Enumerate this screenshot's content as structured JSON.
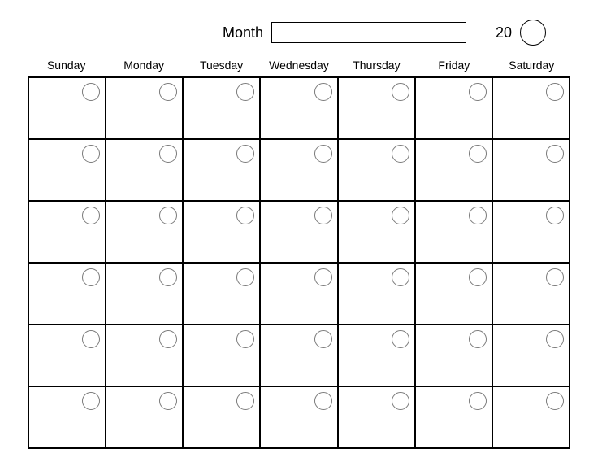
{
  "header": {
    "month_label": "Month",
    "month_value": "",
    "year_prefix": "20",
    "year_value": ""
  },
  "days": [
    "Sunday",
    "Monday",
    "Tuesday",
    "Wednesday",
    "Thursday",
    "Friday",
    "Saturday"
  ],
  "grid": {
    "rows": 6,
    "cols": 7
  }
}
